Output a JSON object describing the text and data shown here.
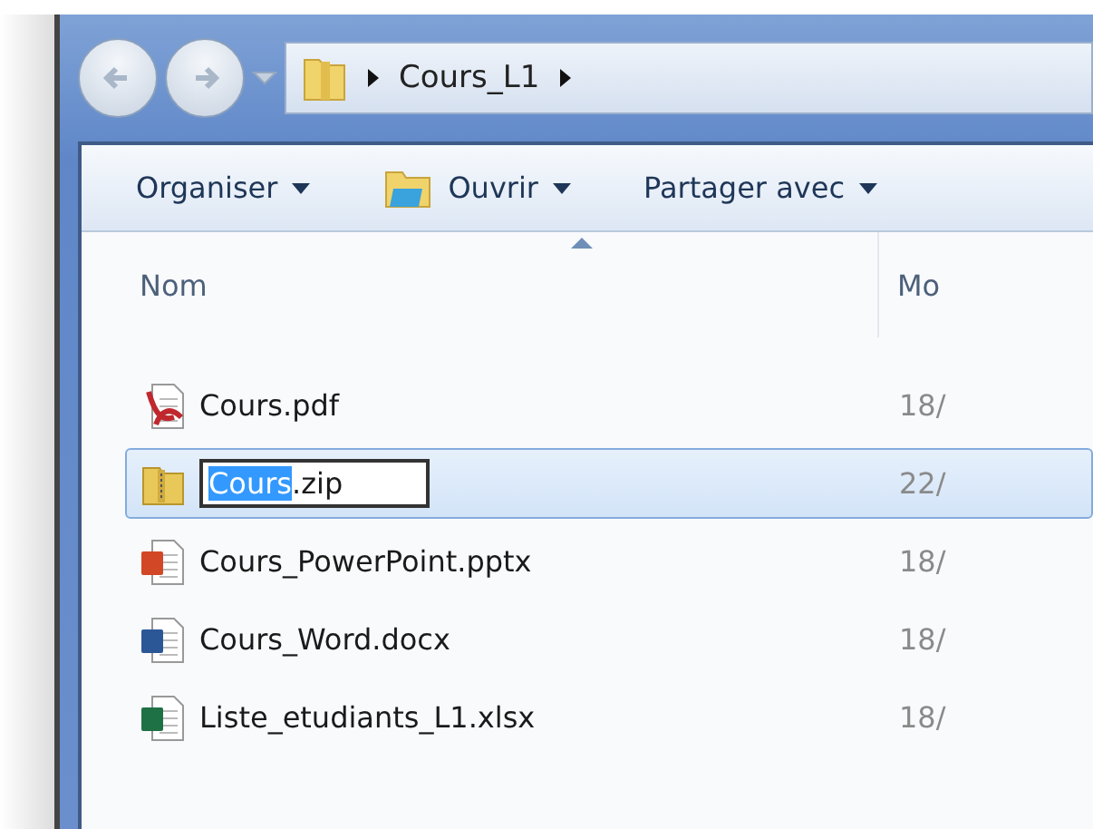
{
  "breadcrumb": [
    "Cours_L1"
  ],
  "toolbar": [
    {
      "label": "Organiser",
      "kind": "plain"
    },
    {
      "label": "Ouvrir",
      "kind": "open"
    },
    {
      "label": "Partager avec",
      "kind": "plain"
    }
  ],
  "columns": [
    "Nom",
    "Mo"
  ],
  "files": [
    {
      "kind": "pdf",
      "name": "Cours.pdf",
      "date": "18/",
      "selected": false,
      "editing": false
    },
    {
      "kind": "zip",
      "name_selected_part": "Cours",
      "name_rest": ".zip",
      "date": "22/",
      "selected": true,
      "editing": true
    },
    {
      "kind": "pptx",
      "name": "Cours_PowerPoint.pptx",
      "date": "18/",
      "selected": false,
      "editing": false
    },
    {
      "kind": "docx",
      "name": "Cours_Word.docx",
      "date": "18/",
      "selected": false,
      "editing": false
    },
    {
      "kind": "xlsx",
      "name": "Liste_etudiants_L1.xlsx",
      "date": "18/",
      "selected": false,
      "editing": false
    }
  ]
}
